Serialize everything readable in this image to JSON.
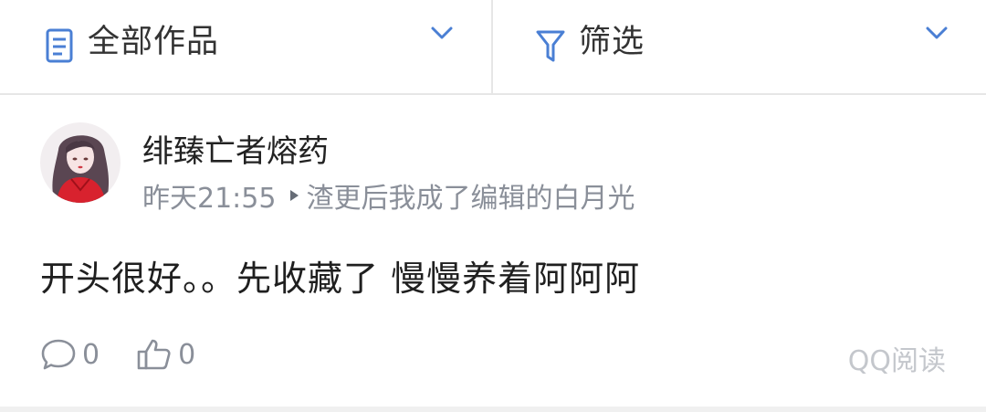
{
  "filter_bar": {
    "works_label": "全部作品",
    "works_icon": "document-icon",
    "filter_label": "筛选",
    "filter_icon": "funnel-icon",
    "accent_color": "#4a7fd4"
  },
  "comment": {
    "username": "绯臻亡者熔药",
    "time": "昨天21:55",
    "chapter": "渣更后我成了编辑的白月光",
    "text": "开头很好。。先收藏了 慢慢养着阿阿阿",
    "reply_count": "0",
    "like_count": "0",
    "source": "QQ阅读"
  }
}
